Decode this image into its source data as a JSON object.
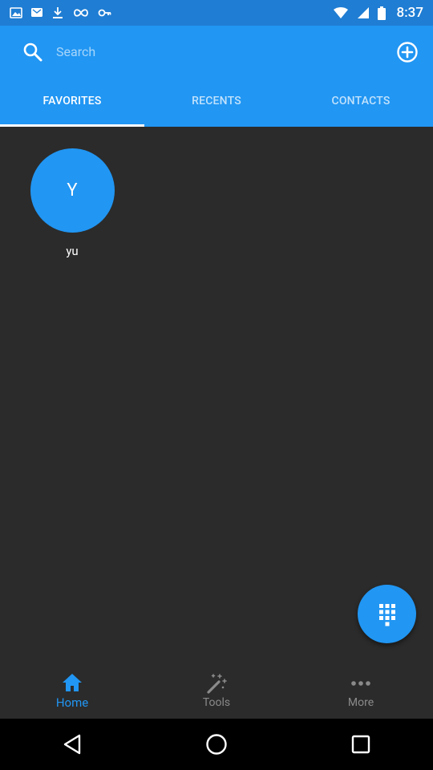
{
  "status_bar": {
    "time": "8:37"
  },
  "search": {
    "placeholder": "Search",
    "value": ""
  },
  "tabs": [
    {
      "label": "FAVORITES",
      "active": true
    },
    {
      "label": "RECENTS",
      "active": false
    },
    {
      "label": "CONTACTS",
      "active": false
    }
  ],
  "favorites": [
    {
      "initial": "Y",
      "name": "yu"
    }
  ],
  "bottom_nav": [
    {
      "label": "Home",
      "icon": "home-icon",
      "active": true
    },
    {
      "label": "Tools",
      "icon": "magic-wand-icon",
      "active": false
    },
    {
      "label": "More",
      "icon": "more-dots-icon",
      "active": false
    }
  ],
  "colors": {
    "primary": "#2196f3",
    "status_bar": "#1f7dd3",
    "background": "#2b2b2b",
    "inactive": "#8a8a8a"
  }
}
